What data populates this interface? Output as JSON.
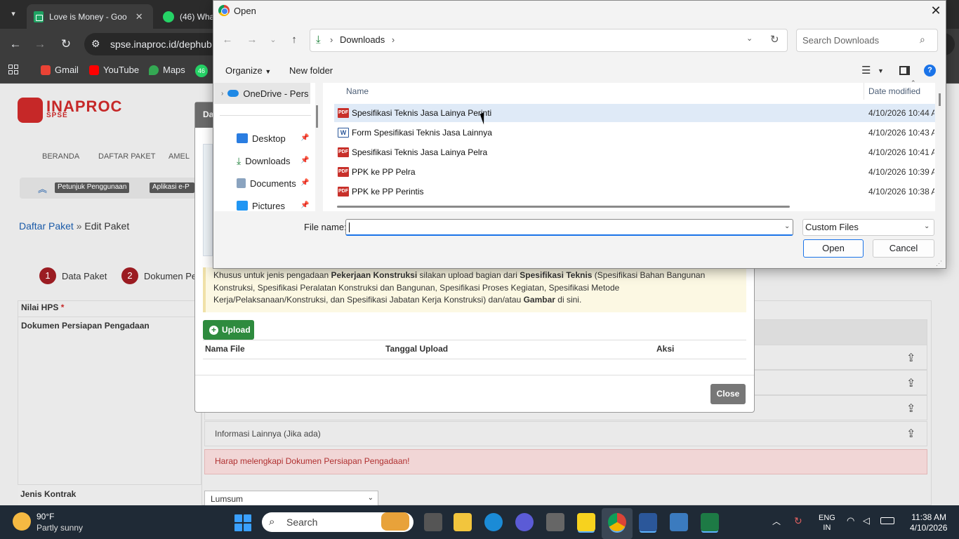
{
  "browser": {
    "tabs": [
      {
        "title": "Love is Money - Goo",
        "icon": "sheets-icon"
      },
      {
        "title": "(46) Wha",
        "icon": "whatsapp-icon"
      }
    ],
    "url": "spse.inaproc.id/dephub",
    "bookmarks": [
      "Gmail",
      "YouTube",
      "Maps",
      "46"
    ]
  },
  "page": {
    "logo_text": "INAPROC",
    "logo_sub": "SPSE",
    "menu": [
      "BERANDA",
      "DAFTAR PAKET",
      "AMEL"
    ],
    "help_pills": [
      "Petunjuk Penggunaan",
      "Aplikasi e-P"
    ],
    "breadcrumb": {
      "root": "Daftar Paket",
      "sep": "»",
      "current": "Edit Paket"
    },
    "steps": [
      {
        "num": "1",
        "label": "Data Paket"
      },
      {
        "num": "2",
        "label": "Dokumen Pe"
      }
    ],
    "nilai_hps": "Nilai HPS",
    "required_mark": "*",
    "dok_persiapan": "Dokumen Persiapan Pengadaan",
    "info_lain": "Informasi Lainnya (Jika ada)",
    "warning": "Harap melengkapi Dokumen Persiapan Pengadaan!",
    "jenis_kontrak": "Jenis Kontrak",
    "jenis_kontrak_value": "Lumsum"
  },
  "modal": {
    "title_fragment": "Da",
    "note_parts": [
      "Khusus untuk jenis pengadaan ",
      "Pekerjaan Konstruksi",
      " silakan upload bagian dari ",
      "Spesifikasi Teknis",
      " (Spesifikasi Bahan Bangunan Konstruksi, Spesifikasi Peralatan Konstruksi dan Bangunan, Spesifikasi Proses Kegiatan, Spesifikasi Metode Kerja/Pelaksanaan/Konstruksi, dan Spesifikasi Jabatan Kerja Konstruksi) dan/atau ",
      "Gambar",
      " di sini."
    ],
    "upload_label": "Upload",
    "columns": [
      "Nama File",
      "Tanggal Upload",
      "Aksi"
    ],
    "close_label": "Close"
  },
  "dialog": {
    "title": "Open",
    "address": "Downloads",
    "search_placeholder": "Search Downloads",
    "organize": "Organize",
    "new_folder": "New folder",
    "nav_items": [
      {
        "label": "OneDrive - Pers",
        "icon": "onedrive-icon"
      },
      {
        "label": "Desktop",
        "icon": "desktop-icon"
      },
      {
        "label": "Downloads",
        "icon": "downloads-icon"
      },
      {
        "label": "Documents",
        "icon": "documents-icon"
      },
      {
        "label": "Pictures",
        "icon": "pictures-icon"
      }
    ],
    "col_name": "Name",
    "col_date": "Date modified",
    "files": [
      {
        "name": "Spesifikasi Teknis Jasa Lainya Perinti",
        "type": "pdf",
        "date": "4/10/2026 10:44 A"
      },
      {
        "name": "Form Spesifikasi Teknis Jasa Lainnya",
        "type": "word",
        "date": "4/10/2026 10:43 A"
      },
      {
        "name": "Spesifikasi Teknis Jasa Lainya Pelra",
        "type": "pdf",
        "date": "4/10/2026 10:41 A"
      },
      {
        "name": "PPK ke PP Pelra",
        "type": "pdf",
        "date": "4/10/2026 10:39 A"
      },
      {
        "name": "PPK ke PP Perintis",
        "type": "pdf",
        "date": "4/10/2026 10:38 A"
      }
    ],
    "file_name_label": "File name:",
    "file_name_value": "",
    "filter": "Custom Files",
    "open_label": "Open",
    "cancel_label": "Cancel"
  },
  "taskbar": {
    "temp": "90°F",
    "condition": "Partly sunny",
    "search_placeholder": "Search",
    "lang_top": "ENG",
    "lang_bottom": "IN",
    "time": "11:38 AM",
    "date": "4/10/2026"
  }
}
